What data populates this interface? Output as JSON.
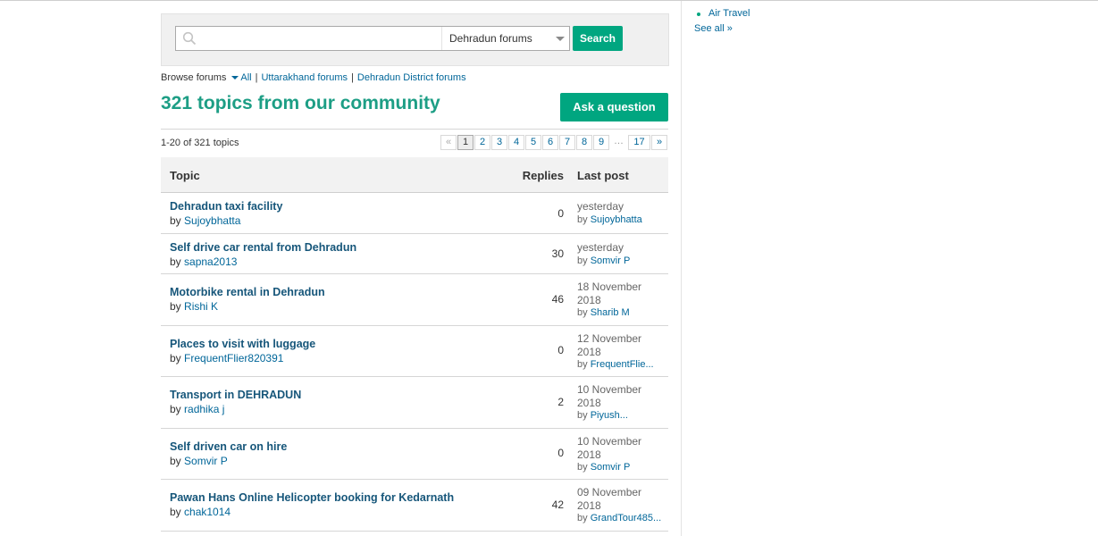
{
  "search": {
    "placeholder": "",
    "value": "",
    "forum_select": "Dehradun forums",
    "button_label": "Search"
  },
  "browse": {
    "label": "Browse forums",
    "all_label": "All",
    "links": [
      "Uttarakhand forums",
      "Dehradun District forums"
    ]
  },
  "page_title": "321 topics from our community",
  "ask_button": "Ask a question",
  "topic_count": "1-20 of 321 topics",
  "pagination": {
    "prev": "«",
    "pages": [
      "1",
      "2",
      "3",
      "4",
      "5",
      "6",
      "7",
      "8",
      "9"
    ],
    "current": "1",
    "ellipsis": "…",
    "last": "17",
    "next": "»"
  },
  "table": {
    "headers": {
      "topic": "Topic",
      "replies": "Replies",
      "last_post": "Last post"
    },
    "rows": [
      {
        "title": "Dehradun taxi facility",
        "by": "by",
        "author": "Sujoybhatta",
        "replies": "0",
        "date_line1": "yesterday",
        "date_line2": "",
        "last_by": "by",
        "last_author": "Sujoybhatta"
      },
      {
        "title": "Self drive car rental from Dehradun",
        "by": "by",
        "author": "sapna2013",
        "replies": "30",
        "date_line1": "yesterday",
        "date_line2": "",
        "last_by": "by",
        "last_author": "Somvir P"
      },
      {
        "title": "Motorbike rental in Dehradun",
        "by": "by",
        "author": "Rishi K",
        "replies": "46",
        "date_line1": "18 November",
        "date_line2": "2018",
        "last_by": "by",
        "last_author": "Sharib M"
      },
      {
        "title": "Places to visit with luggage",
        "by": "by",
        "author": "FrequentFlier820391",
        "replies": "0",
        "date_line1": "12 November",
        "date_line2": "2018",
        "last_by": "by",
        "last_author": "FrequentFlie..."
      },
      {
        "title": "Transport in DEHRADUN",
        "by": "by",
        "author": "radhika j",
        "replies": "2",
        "date_line1": "10 November",
        "date_line2": "2018",
        "last_by": "by",
        "last_author": "Piyush..."
      },
      {
        "title": "Self driven car on hire",
        "by": "by",
        "author": "Somvir P",
        "replies": "0",
        "date_line1": "10 November",
        "date_line2": "2018",
        "last_by": "by",
        "last_author": "Somvir P"
      },
      {
        "title": "Pawan Hans Online Helicopter booking for Kedarnath",
        "by": "by",
        "author": "chak1014",
        "replies": "42",
        "date_line1": "09 November",
        "date_line2": "2018",
        "last_by": "by",
        "last_author": "GrandTour485..."
      }
    ]
  },
  "sidebar": {
    "items": [
      "Air Travel"
    ],
    "see_all": "See all »"
  },
  "colors": {
    "accent": "#00a680",
    "title_green": "#1d9e85",
    "link_blue": "#006699",
    "topic_blue": "#16567a"
  },
  "icons": {
    "search": "search-icon",
    "dropdown": "chevron-down-icon",
    "bullet": "bullet-icon"
  }
}
